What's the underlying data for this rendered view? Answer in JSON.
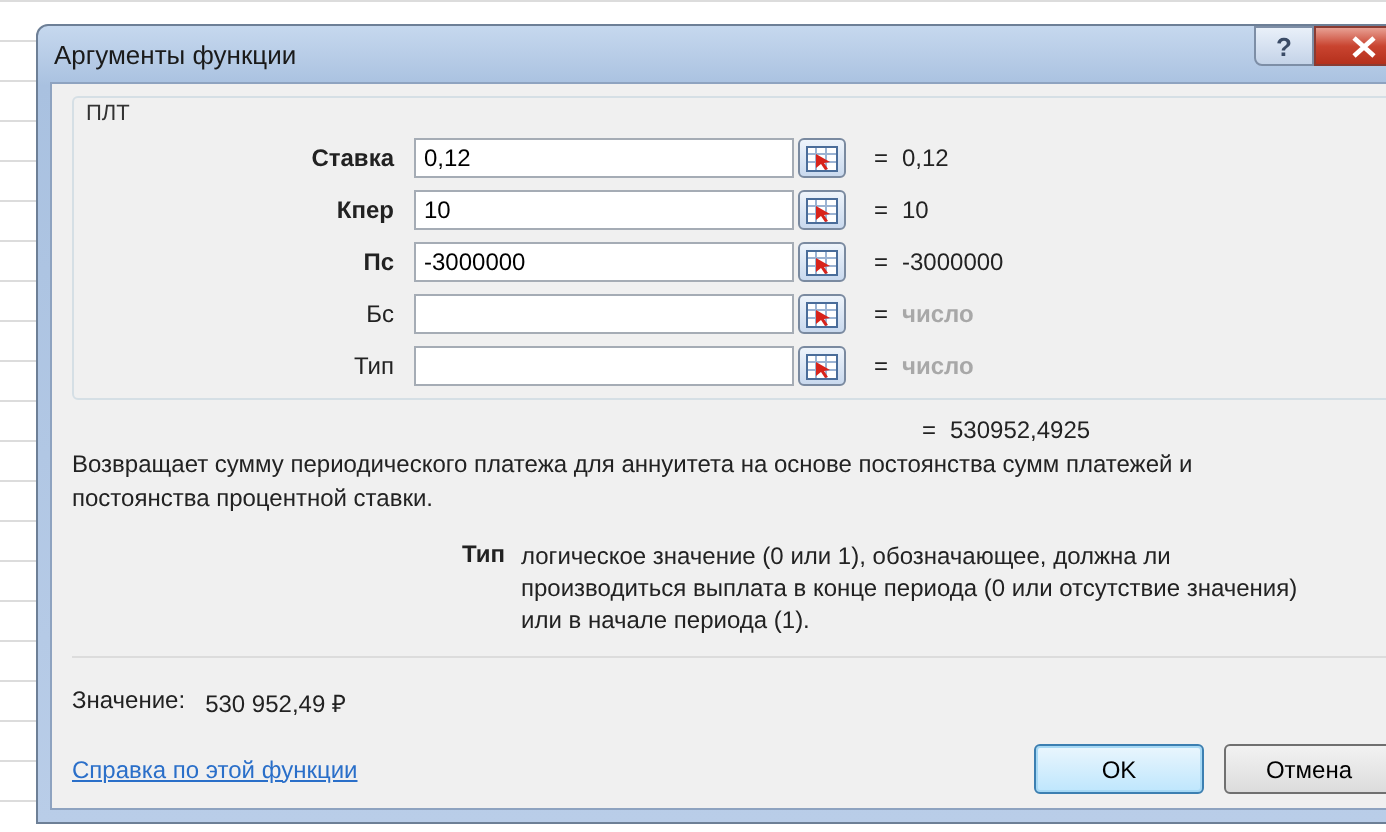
{
  "window": {
    "title": "Аргументы функции",
    "help_glyph": "?"
  },
  "function_name": "ПЛТ",
  "arguments": [
    {
      "label": "Ставка",
      "required": true,
      "value": "0,12",
      "equals": "=",
      "result": "0,12",
      "result_hint": false
    },
    {
      "label": "Кпер",
      "required": true,
      "value": "10",
      "equals": "=",
      "result": "10",
      "result_hint": false
    },
    {
      "label": "Пс",
      "required": true,
      "value": "-3000000",
      "equals": "=",
      "result": "-3000000",
      "result_hint": false
    },
    {
      "label": "Бс",
      "required": false,
      "equals": "=",
      "result": "число",
      "result_hint": true
    },
    {
      "label": "Тип",
      "required": false,
      "equals": "=",
      "result": "число",
      "result_hint": true
    }
  ],
  "formula_equals": "=",
  "formula_result": "530952,4925",
  "description": "Возвращает сумму периодического платежа для аннуитета на основе постоянства сумм платежей и постоянства процентной ставки.",
  "argument_help": {
    "name": "Тип",
    "text": "логическое значение (0 или 1), обозначающее, должна ли производиться выплата в конце периода (0 или отсутствие значения) или в начале периода (1)."
  },
  "value_label": "Значение:",
  "value": "530 952,49 ₽",
  "help_link": "Справка по этой функции",
  "buttons": [
    {
      "label": "OK",
      "default": true
    },
    {
      "label": "Отмена",
      "default": false
    }
  ]
}
